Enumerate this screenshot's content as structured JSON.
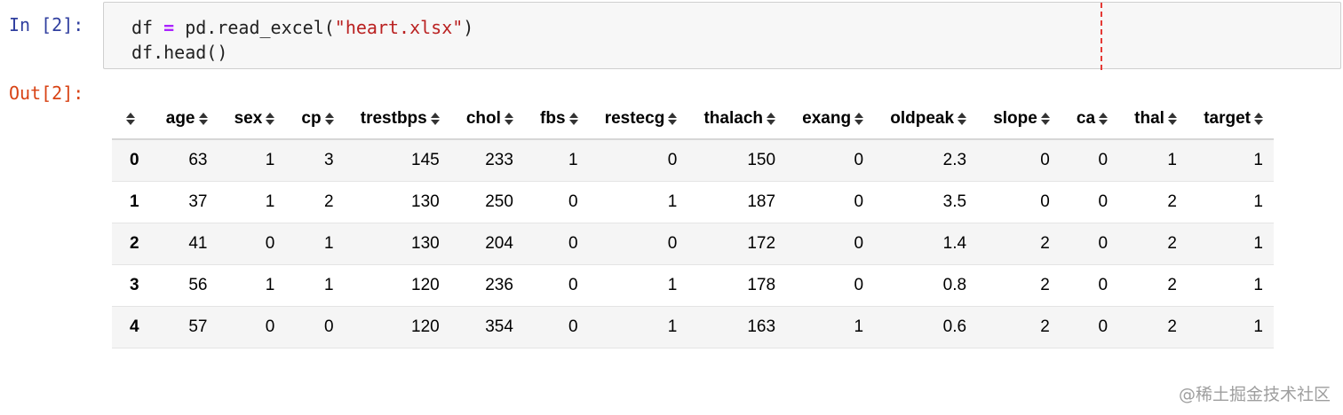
{
  "cell": {
    "in_prompt": "In [2]:",
    "out_prompt": "Out[2]:",
    "code_line1": [
      {
        "text": "df ",
        "cls": ""
      },
      {
        "text": "=",
        "cls": "tok-op"
      },
      {
        "text": " pd.read_excel(",
        "cls": ""
      },
      {
        "text": "\"heart.xlsx\"",
        "cls": "tok-str"
      },
      {
        "text": ")",
        "cls": ""
      }
    ],
    "code_line2": "df.head()"
  },
  "table": {
    "sort_icon": "sort-up-down-icon",
    "columns": [
      "age",
      "sex",
      "cp",
      "trestbps",
      "chol",
      "fbs",
      "restecg",
      "thalach",
      "exang",
      "oldpeak",
      "slope",
      "ca",
      "thal",
      "target"
    ],
    "rows": [
      {
        "index": "0",
        "values": [
          "63",
          "1",
          "3",
          "145",
          "233",
          "1",
          "0",
          "150",
          "0",
          "2.3",
          "0",
          "0",
          "1",
          "1"
        ]
      },
      {
        "index": "1",
        "values": [
          "37",
          "1",
          "2",
          "130",
          "250",
          "0",
          "1",
          "187",
          "0",
          "3.5",
          "0",
          "0",
          "2",
          "1"
        ]
      },
      {
        "index": "2",
        "values": [
          "41",
          "0",
          "1",
          "130",
          "204",
          "0",
          "0",
          "172",
          "0",
          "1.4",
          "2",
          "0",
          "2",
          "1"
        ]
      },
      {
        "index": "3",
        "values": [
          "56",
          "1",
          "1",
          "120",
          "236",
          "0",
          "1",
          "178",
          "0",
          "0.8",
          "2",
          "0",
          "2",
          "1"
        ]
      },
      {
        "index": "4",
        "values": [
          "57",
          "0",
          "0",
          "120",
          "354",
          "0",
          "1",
          "163",
          "1",
          "0.6",
          "2",
          "0",
          "2",
          "1"
        ]
      }
    ]
  },
  "watermark": "@稀土掘金技术社区"
}
